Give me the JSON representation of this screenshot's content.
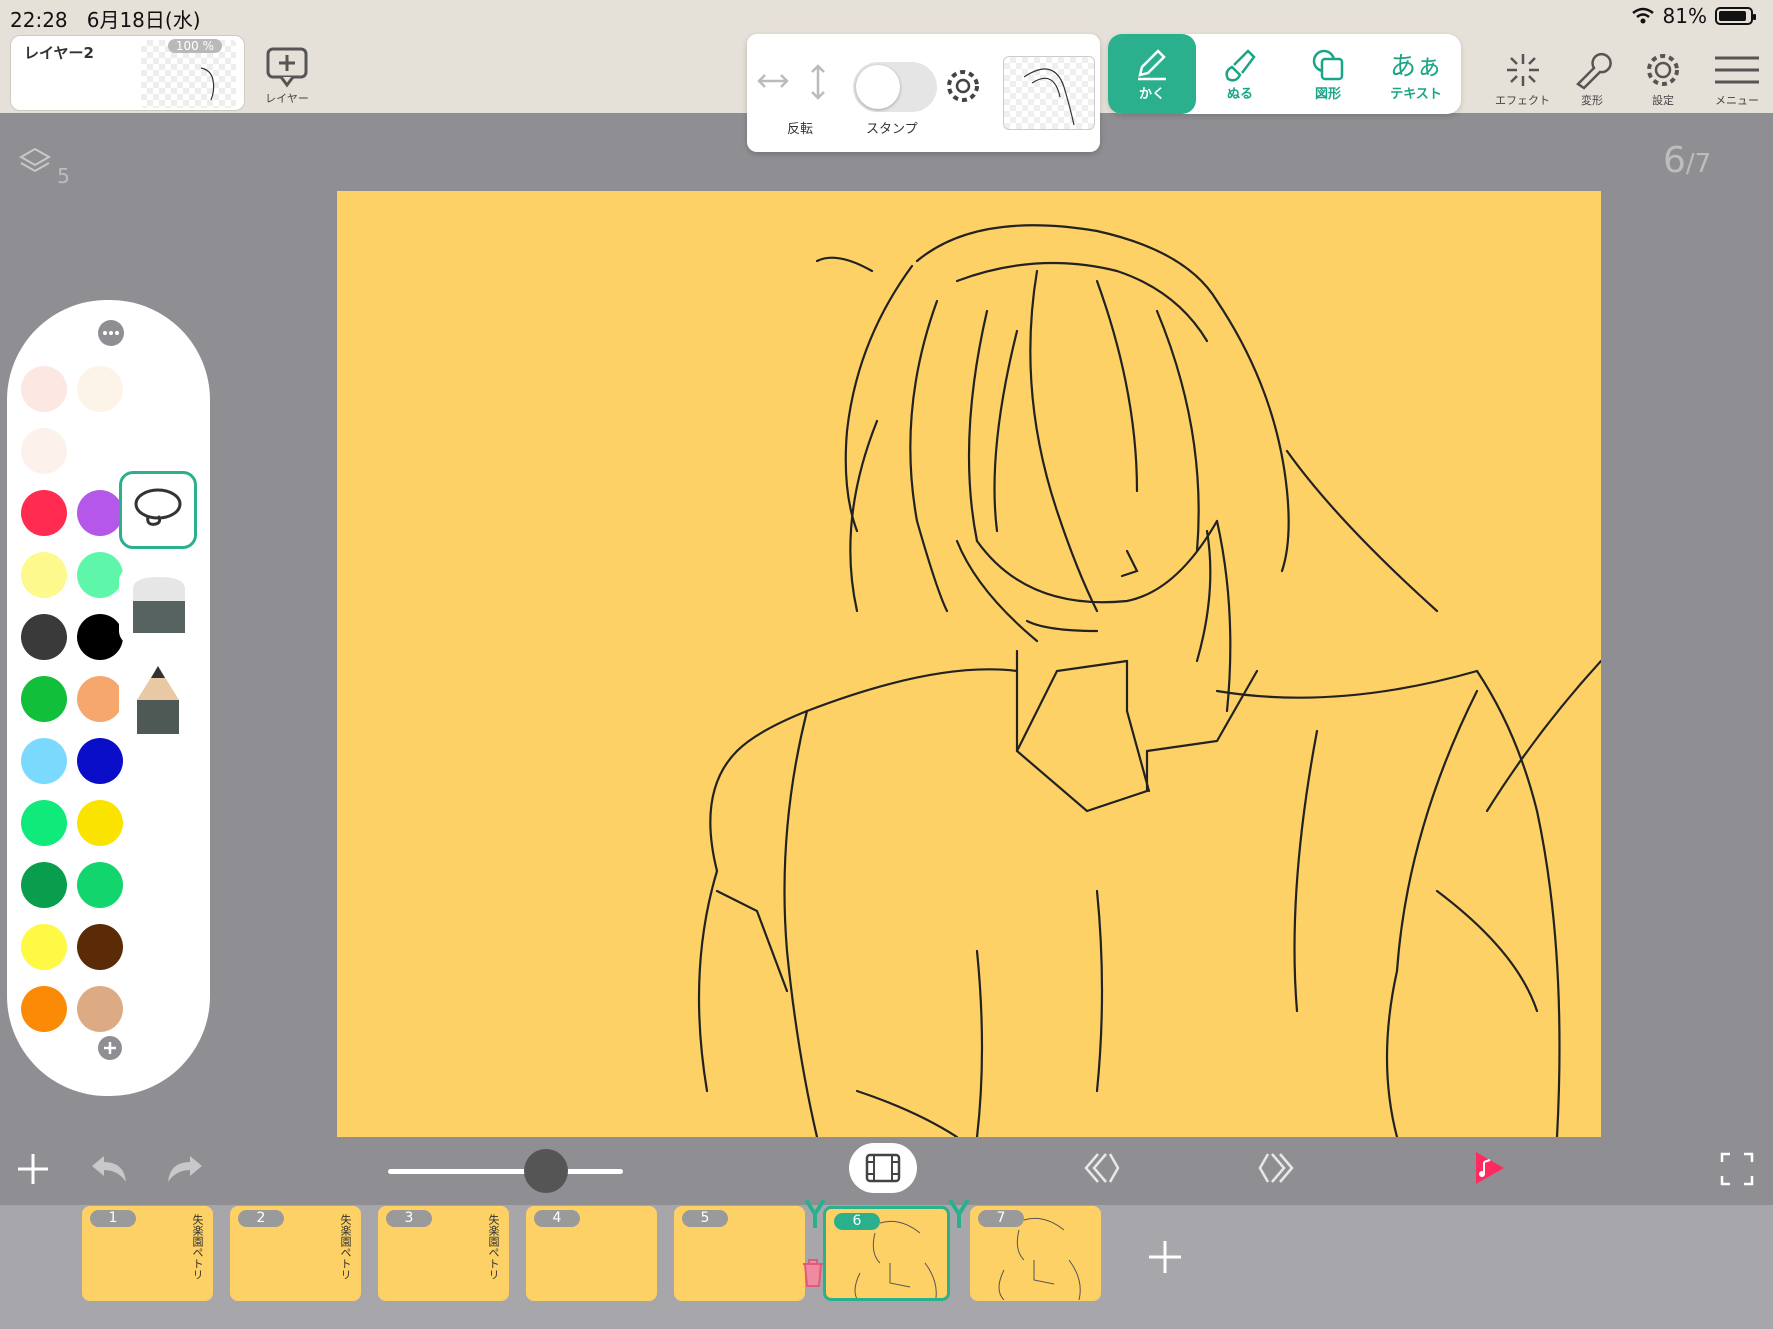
{
  "status": {
    "time": "22:28",
    "date": "6月18日(水)",
    "battery": "81%",
    "battery_level": 0.81
  },
  "layer": {
    "name": "レイヤー2",
    "opacity": "100 %"
  },
  "toolbar": {
    "layer_btn": "レイヤー",
    "flip": "反転",
    "stamp": "スタンプ",
    "tabs": [
      {
        "label": "かく"
      },
      {
        "label": "ぬる"
      },
      {
        "label": "図形"
      },
      {
        "label": "テキスト",
        "icon_text": "あぁ"
      }
    ],
    "right": [
      {
        "label": "エフェクト"
      },
      {
        "label": "変形"
      },
      {
        "label": "設定"
      },
      {
        "label": "メニュー"
      }
    ]
  },
  "layers_count": "5",
  "page": {
    "current": "6",
    "total": "7"
  },
  "palette": {
    "colors": [
      "#fde7e3",
      "#fcf5e7",
      "#fdf1ec",
      "#ffffff",
      "#ff2b50",
      "#b557e9",
      "#fdf98c",
      "#5ef7aa",
      "#3a3a3a",
      "#000000",
      "#12bf3a",
      "#f5a76d",
      "#7ad9fd",
      "#0b0ec8",
      "#0fea7a",
      "#fbe300",
      "#089e4d",
      "#12d56d",
      "#fef945",
      "#5b2a07",
      "#fb8a06",
      "#ddab83"
    ]
  },
  "frames": [
    {
      "num": "1",
      "text": "失楽園ペトリ"
    },
    {
      "num": "2",
      "text": "失楽園ペトリ"
    },
    {
      "num": "3",
      "text": "失楽園ペトリ"
    },
    {
      "num": "4",
      "text": ""
    },
    {
      "num": "5",
      "text": ""
    },
    {
      "num": "6",
      "text": ""
    },
    {
      "num": "7",
      "text": ""
    }
  ],
  "colors": {
    "accent": "#2bb08e",
    "canvas": "#fdd165",
    "play": "#ff2b60"
  }
}
